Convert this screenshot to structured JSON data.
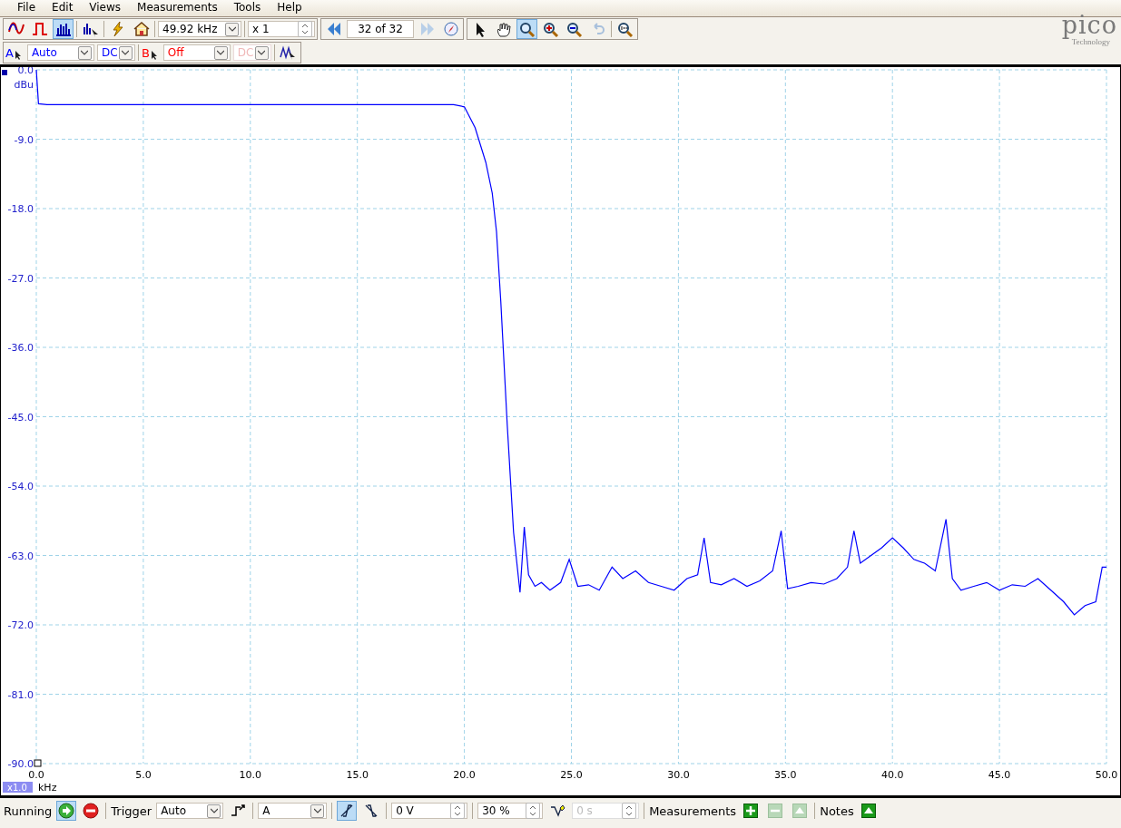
{
  "menu": [
    {
      "label": "File"
    },
    {
      "label": "Edit"
    },
    {
      "label": "Views"
    },
    {
      "label": "Measurements"
    },
    {
      "label": "Tools"
    },
    {
      "label": "Help"
    }
  ],
  "view_modes": [
    {
      "kind": "scope",
      "selected": false
    },
    {
      "kind": "persistence",
      "selected": false
    },
    {
      "kind": "spectrum",
      "selected": true
    }
  ],
  "timebase": {
    "value": "49.92 kHz"
  },
  "multiplier": {
    "value": "x 1"
  },
  "buffer": {
    "value": "32 of 32"
  },
  "tools": [
    {
      "kind": "pointer",
      "selected": false,
      "disabled": false
    },
    {
      "kind": "hand",
      "selected": false,
      "disabled": false
    },
    {
      "kind": "zoom",
      "selected": true,
      "disabled": false
    },
    {
      "kind": "zoom-in",
      "selected": false,
      "disabled": false
    },
    {
      "kind": "zoom-out",
      "selected": false,
      "disabled": false
    },
    {
      "kind": "undo",
      "selected": false,
      "disabled": true
    }
  ],
  "logo": {
    "name": "pico",
    "tagline": "Technology"
  },
  "channels": [
    {
      "name": "A",
      "range": "Auto",
      "coupling": "DC",
      "color": "#0000ff",
      "enabled": true
    },
    {
      "name": "B",
      "range": "Off",
      "coupling": "DC",
      "color": "#ff0000",
      "enabled": false
    }
  ],
  "plot": {
    "zoom_badge": "x1.0",
    "chart_data": {
      "type": "line",
      "grid": true,
      "xlabel": "kHz",
      "ylabel": "dBu",
      "xlim": [
        0,
        50
      ],
      "ylim": [
        -90,
        0
      ],
      "xticks": [
        {
          "value": 0,
          "label": "0.0"
        },
        {
          "value": 5,
          "label": "5.0"
        },
        {
          "value": 10,
          "label": "10.0"
        },
        {
          "value": 15,
          "label": "15.0"
        },
        {
          "value": 20,
          "label": "20.0"
        },
        {
          "value": 25,
          "label": "25.0"
        },
        {
          "value": 30,
          "label": "30.0"
        },
        {
          "value": 35,
          "label": "35.0"
        },
        {
          "value": 40,
          "label": "40.0"
        },
        {
          "value": 45,
          "label": "45.0"
        },
        {
          "value": 50,
          "label": "50.0"
        }
      ],
      "yticks": [
        {
          "value": 0,
          "label": "0.0"
        },
        {
          "value": -9,
          "label": "-9.0"
        },
        {
          "value": -18,
          "label": "-18.0"
        },
        {
          "value": -27,
          "label": "-27.0"
        },
        {
          "value": -36,
          "label": "-36.0"
        },
        {
          "value": -45,
          "label": "-45.0"
        },
        {
          "value": -54,
          "label": "-54.0"
        },
        {
          "value": -63,
          "label": "-63.0"
        },
        {
          "value": -72,
          "label": "-72.0"
        },
        {
          "value": -81,
          "label": "-81.0"
        },
        {
          "value": -90,
          "label": "-90.0"
        }
      ],
      "x": [
        0,
        0.1,
        0.5,
        5,
        10,
        15,
        19.5,
        20,
        20.5,
        21,
        21.3,
        21.5,
        21.7,
        22,
        22.3,
        22.6,
        22.8,
        23.0,
        23.3,
        23.6,
        24,
        24.5,
        24.9,
        25.3,
        25.8,
        26.3,
        26.9,
        27.4,
        28,
        28.6,
        29.2,
        29.8,
        30.4,
        30.9,
        31.2,
        31.5,
        32,
        32.6,
        33.2,
        33.8,
        34.4,
        34.8,
        35.1,
        35.6,
        36.2,
        36.8,
        37.4,
        37.9,
        38.2,
        38.5,
        39,
        39.5,
        40,
        40.5,
        41,
        41.5,
        42,
        42.5,
        42.8,
        43.2,
        43.8,
        44.4,
        45,
        45.6,
        46.2,
        46.8,
        47.4,
        48,
        48.5,
        49,
        49.5,
        49.8,
        50
      ],
      "series": [
        {
          "color": "#0000ff",
          "values": [
            0,
            -4.4,
            -4.5,
            -4.5,
            -4.5,
            -4.5,
            -4.5,
            -4.8,
            -7.5,
            -12,
            -16,
            -21,
            -30,
            -46,
            -60,
            -67.8,
            -59.3,
            -65.5,
            -67,
            -66.5,
            -67.5,
            -66.5,
            -63.5,
            -67,
            -66.8,
            -67.5,
            -64.5,
            -66,
            -65,
            -66.5,
            -67,
            -67.5,
            -66,
            -65.5,
            -60.7,
            -66.5,
            -66.8,
            -66,
            -67,
            -66.3,
            -65,
            -59.8,
            -67.3,
            -67,
            -66.5,
            -66.7,
            -66,
            -64.5,
            -59.8,
            -64,
            -63,
            -62,
            -60.7,
            -62,
            -63.5,
            -64,
            -65,
            -58.3,
            -66,
            -67.5,
            -67,
            -66.5,
            -67.5,
            -66.8,
            -67,
            -66,
            -67.5,
            -69,
            -70.7,
            -69.5,
            -69,
            -64.5,
            -64.5
          ]
        }
      ]
    }
  },
  "status": {
    "state": "Running",
    "trigger_label": "Trigger",
    "trigger_mode": "Auto",
    "trigger_source": "A",
    "edges": [
      {
        "kind": "rising",
        "selected": true
      },
      {
        "kind": "falling",
        "selected": false
      }
    ],
    "threshold": "0 V",
    "pretrigger": "30 %",
    "delay": "0 s",
    "delay_disabled": true,
    "measurements_label": "Measurements",
    "measurement_buttons": [
      {
        "kind": "add",
        "disabled": false
      },
      {
        "kind": "remove",
        "disabled": true
      },
      {
        "kind": "up",
        "disabled": true
      }
    ],
    "notes_label": "Notes"
  }
}
